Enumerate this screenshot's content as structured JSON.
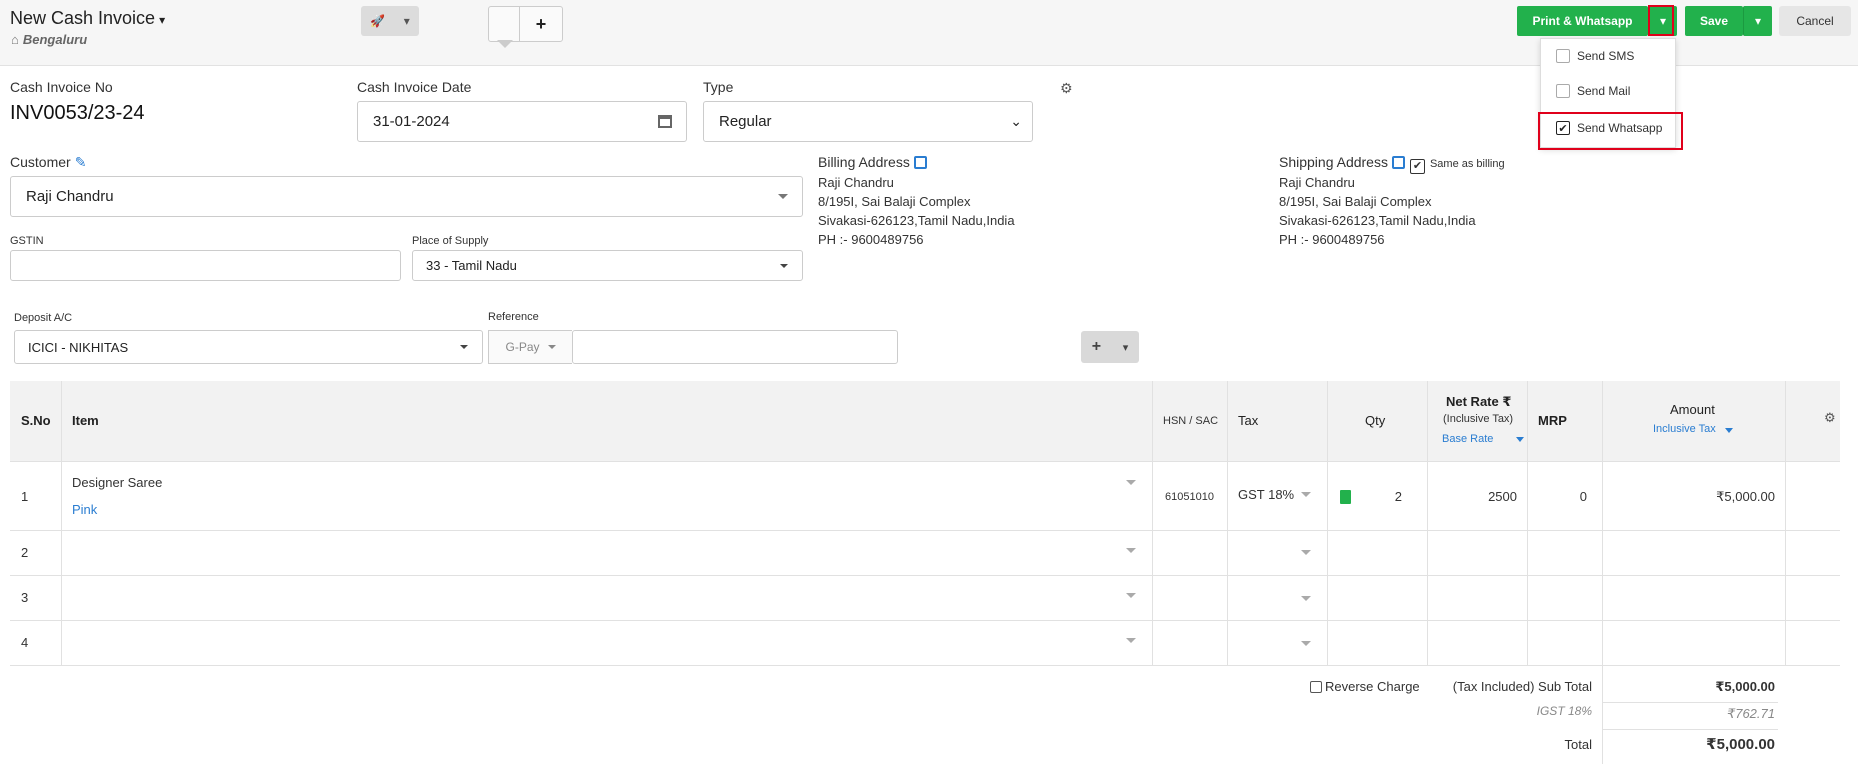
{
  "header": {
    "title": "New Cash Invoice",
    "branch": "Bengaluru",
    "print_whatsapp_label": "Print & Whatsapp",
    "save_label": "Save",
    "cancel_label": "Cancel",
    "send_menu": [
      {
        "label": "Send SMS",
        "checked": false
      },
      {
        "label": "Send Mail",
        "checked": false
      },
      {
        "label": "Send Whatsapp",
        "checked": true
      }
    ]
  },
  "invoice": {
    "no_label": "Cash Invoice No",
    "no_value": "INV0053/23-24",
    "date_label": "Cash Invoice Date",
    "date_value": "31-01-2024",
    "type_label": "Type",
    "type_value": "Regular"
  },
  "customer": {
    "label": "Customer",
    "value": "Raji Chandru",
    "gstin_label": "GSTIN",
    "gstin_value": "",
    "pos_label": "Place of Supply",
    "pos_value": "33 - Tamil Nadu"
  },
  "billing": {
    "label": "Billing Address",
    "lines": [
      "Raji Chandru",
      "8/195I, Sai Balaji Complex",
      "Sivakasi-626123,Tamil Nadu,India",
      "PH :- 9600489756"
    ]
  },
  "shipping": {
    "label": "Shipping Address",
    "same_as_billing": "Same as billing",
    "lines": [
      "Raji Chandru",
      "8/195I, Sai Balaji Complex",
      "Sivakasi-626123,Tamil Nadu,India",
      "PH :- 9600489756"
    ]
  },
  "deposit": {
    "label": "Deposit A/C",
    "value": "ICICI - NIKHITAS",
    "ref_label": "Reference",
    "ref_prefix": "G-Pay",
    "ref_value": ""
  },
  "table": {
    "headers": {
      "sno": "S.No",
      "item": "Item",
      "hsn": "HSN / SAC",
      "tax": "Tax",
      "qty": "Qty",
      "net_rate": "Net Rate ₹",
      "net_rate_sub": "(Inclusive Tax)",
      "base_rate": "Base Rate",
      "mrp": "MRP",
      "amount": "Amount",
      "inclusive_tax": "Inclusive Tax"
    },
    "rows": [
      {
        "sno": "1",
        "item": "Designer Saree",
        "variant": "Pink",
        "hsn": "61051010",
        "tax": "GST 18%",
        "qty": "2",
        "rate": "2500",
        "mrp": "0",
        "amount": "₹5,000.00"
      },
      {
        "sno": "2"
      },
      {
        "sno": "3"
      },
      {
        "sno": "4"
      }
    ]
  },
  "summary": {
    "reverse_charge": "Reverse Charge",
    "subtotal_label": "(Tax Included) Sub Total",
    "subtotal_value": "₹5,000.00",
    "igst_label": "IGST 18%",
    "igst_value": "₹762.71",
    "total_label": "Total",
    "total_value": "₹5,000.00"
  }
}
